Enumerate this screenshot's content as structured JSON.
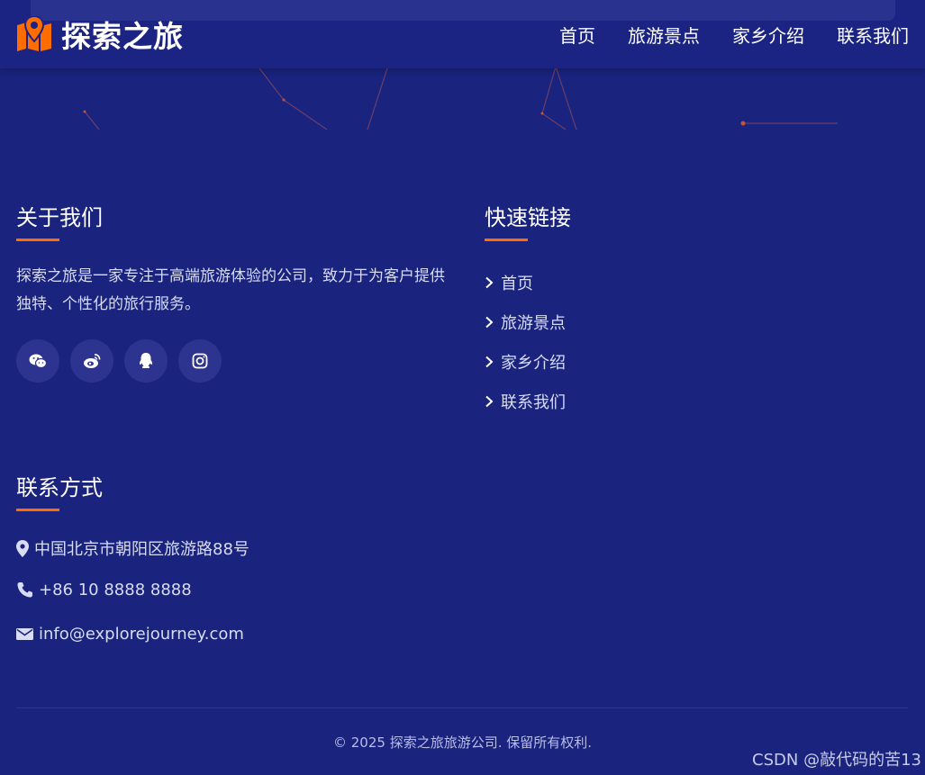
{
  "header": {
    "brand": "探索之旅",
    "nav": [
      "首页",
      "旅游景点",
      "家乡介绍",
      "联系我们"
    ]
  },
  "about": {
    "title": "关于我们",
    "text": "探索之旅是一家专注于高端旅游体验的公司，致力于为客户提供独特、个性化的旅行服务。",
    "socials": [
      "wechat-icon",
      "weibo-icon",
      "qq-icon",
      "instagram-icon"
    ]
  },
  "quick_links": {
    "title": "快速链接",
    "items": [
      "首页",
      "旅游景点",
      "家乡介绍",
      "联系我们"
    ]
  },
  "contact": {
    "title": "联系方式",
    "address": "中国北京市朝阳区旅游路88号",
    "phone": "+86 10 8888 8888",
    "email": "info@explorejourney.com"
  },
  "footer": {
    "copyright": "© 2025 探索之旅旅游公司. 保留所有权利.",
    "watermark": "CSDN @敲代码的苦13"
  },
  "colors": {
    "background": "#1a237e",
    "accent": "#ff6d00",
    "text": "#ffffff"
  }
}
